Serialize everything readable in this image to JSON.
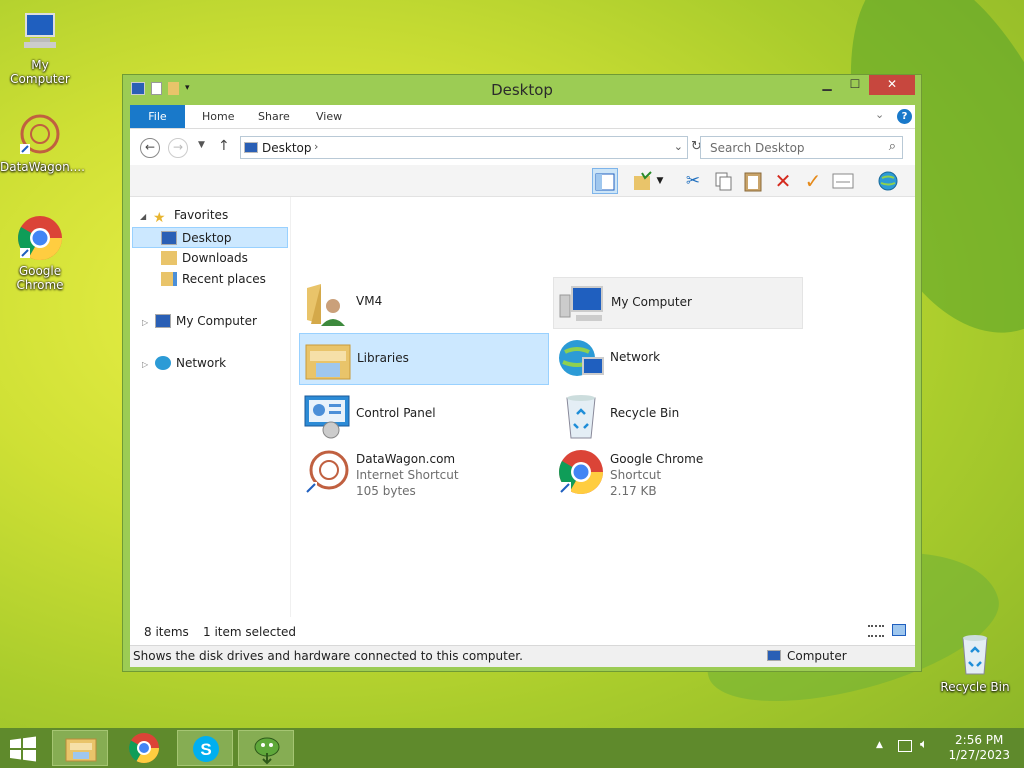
{
  "desktop": {
    "icons": [
      {
        "label": "My Computer"
      },
      {
        "label": "DataWagon...."
      },
      {
        "label": "Google Chrome"
      },
      {
        "label": "Recycle Bin"
      }
    ]
  },
  "window": {
    "title": "Desktop",
    "controls": {
      "minimize": "▁",
      "maximize": "☐",
      "close": "✕"
    },
    "ribbon_tabs": [
      "File",
      "Home",
      "Share",
      "View"
    ],
    "address": {
      "path": "Desktop"
    },
    "search": {
      "placeholder": "Search Desktop"
    },
    "nav_pane": {
      "favorites": "Favorites",
      "favorites_items": [
        "Desktop",
        "Downloads",
        "Recent places"
      ],
      "my_computer": "My Computer",
      "network": "Network",
      "selected": "Desktop"
    },
    "items": [
      {
        "name": "VM4",
        "icon": "user-folder-icon"
      },
      {
        "name": "My Computer",
        "icon": "computer-icon",
        "state": "hover"
      },
      {
        "name": "Libraries",
        "icon": "libraries-icon",
        "state": "selected"
      },
      {
        "name": "Network",
        "icon": "network-icon"
      },
      {
        "name": "Control Panel",
        "icon": "control-panel-icon"
      },
      {
        "name": "Recycle Bin",
        "icon": "recycle-bin-icon"
      },
      {
        "name": "DataWagon.com",
        "type": "Internet Shortcut",
        "size": "105 bytes",
        "icon": "datawagon-icon"
      },
      {
        "name": "Google Chrome",
        "type": "Shortcut",
        "size": "2.17 KB",
        "icon": "chrome-icon"
      }
    ],
    "status": {
      "item_count": "8 items",
      "selection": "1 item selected",
      "description": "Shows the disk drives and hardware connected to this computer.",
      "location": "Computer"
    }
  },
  "taskbar": {
    "time": "2:56 PM",
    "date": "1/27/2023"
  },
  "colors": {
    "window_frame": "#9ccc54",
    "file_tab": "#1979ca",
    "selection": "#cce8ff",
    "taskbar": "#5f8a2c"
  }
}
